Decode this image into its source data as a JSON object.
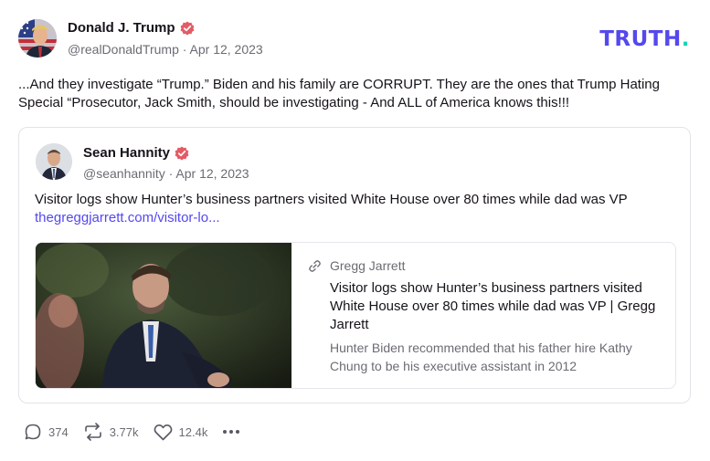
{
  "author": {
    "name": "Donald J. Trump",
    "handle": "@realDonaldTrump",
    "date": "Apr 12, 2023",
    "verified_color": "#e45b66"
  },
  "brand": {
    "logo_text": "TRUTH",
    "logo_dot": ".",
    "logo_color": "#5448ee",
    "dot_color": "#17d2b7"
  },
  "post": {
    "text": "...And they investigate “Trump.” Biden and his family are CORRUPT. They are the ones that Trump Hating Special “Prosecutor, Jack Smith, should be investigating - And ALL of America knows this!!!"
  },
  "quote": {
    "author": {
      "name": "Sean Hannity",
      "handle": "@seanhannity",
      "date": "Apr 12, 2023"
    },
    "text": "Visitor logs show Hunter’s business partners visited White House over 80 times while dad was VP",
    "link": "thegreggjarrett.com/visitor-lo...",
    "link_color": "#5448ee",
    "card": {
      "source": "Gregg Jarrett",
      "title": "Visitor logs show Hunter’s business partners visited White House over 80 times while dad was VP | Gregg Jarrett",
      "description": "Hunter Biden recommended that his father hire Kathy Chung to be his executive assistant in 2012"
    }
  },
  "actions": {
    "replies": "374",
    "retruths": "3.77k",
    "likes": "12.4k",
    "more_icon": "more-icon"
  }
}
